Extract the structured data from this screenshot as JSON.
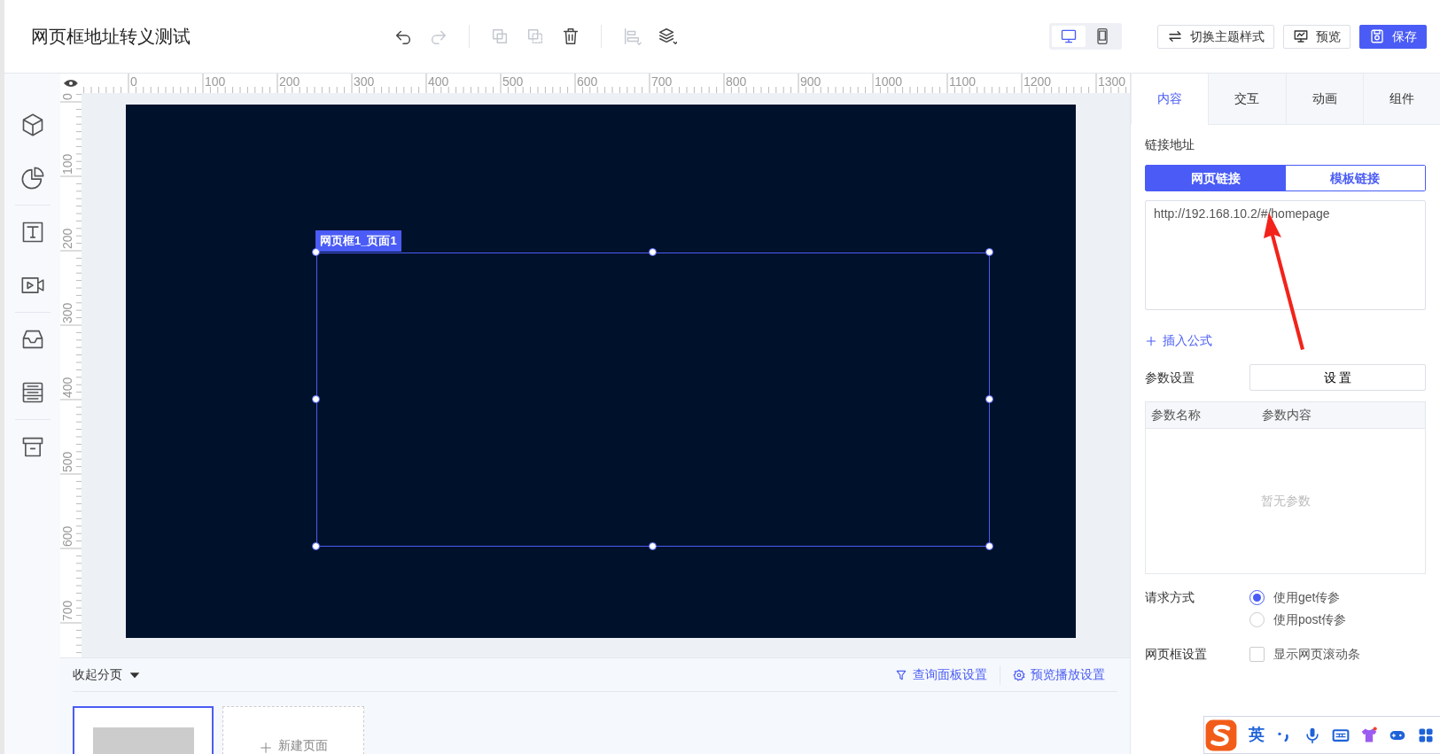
{
  "header": {
    "title": "网页框地址转义测试",
    "toolbar": [
      {
        "disabled": false
      },
      {
        "disabled": true
      },
      {
        "disabled": true
      },
      {
        "disabled": true
      },
      {
        "disabled": false
      },
      {
        "disabled": true
      },
      {
        "disabled": false
      }
    ],
    "device_toggle": [
      {
        "kind": "desktop",
        "selected": true
      },
      {
        "kind": "tablet",
        "selected": false
      }
    ],
    "buttons": [
      {
        "kind": "swap",
        "label": "切换主题样式",
        "primary": false
      },
      {
        "kind": "monitor",
        "label": "预览",
        "primary": false
      },
      {
        "kind": "save",
        "label": "保存",
        "primary": true
      }
    ]
  },
  "ruler": {
    "x_labels": [
      "0",
      "100",
      "200",
      "300",
      "400",
      "500",
      "600",
      "700",
      "800",
      "900",
      "1000",
      "1100",
      "1200",
      "1300"
    ],
    "y_labels": [
      "0",
      "100",
      "200",
      "300",
      "400",
      "500",
      "600",
      "700"
    ]
  },
  "canvas": {
    "frame_label": "网页框1_页面1"
  },
  "bottom_panel": {
    "collapse": "收起分页",
    "links": [
      {
        "kind": "filter",
        "label": "查询面板设置"
      },
      {
        "kind": "gear",
        "label": "预览播放设置"
      }
    ],
    "pages": [
      {
        "selected": true
      }
    ],
    "new_page": "新建页面"
  },
  "right_panel": {
    "tabs": [
      {
        "label": "内容",
        "selected": true
      },
      {
        "label": "交互",
        "selected": false
      },
      {
        "label": "动画",
        "selected": false
      },
      {
        "label": "组件",
        "selected": false
      }
    ],
    "link_label": "链接地址",
    "link_modes": [
      {
        "label": "网页链接",
        "selected": true
      },
      {
        "label": "模板链接",
        "selected": false
      }
    ],
    "url": {
      "value": "http://192.168.10.2/#/homepage"
    },
    "insert_formula": "插入公式",
    "params": {
      "label": "参数设置",
      "button": "设 置",
      "columns": [
        "参数名称",
        "参数内容"
      ],
      "empty": "暂无参数"
    },
    "request": {
      "label": "请求方式",
      "options": [
        {
          "label": "使用get传参",
          "selected": true
        },
        {
          "label": "使用post传参",
          "selected": false
        }
      ]
    },
    "frame_settings": {
      "label": "网页框设置",
      "checkbox": {
        "label": "显示网页滚动条",
        "checked": false
      }
    }
  },
  "ime": {
    "mode": "英"
  }
}
